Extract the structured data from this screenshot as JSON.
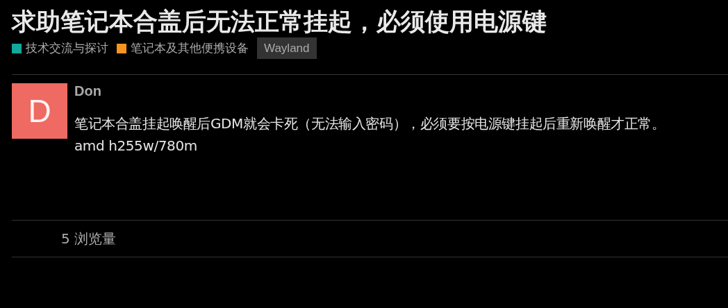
{
  "title": "求助笔记本合盖后无法正常挂起，必须使用电源键",
  "categories": [
    {
      "label": "技术交流与探讨",
      "color": "#12a89d"
    },
    {
      "label": "笔记本及其他便携设备",
      "color": "#f7941d"
    }
  ],
  "tags": [
    "Wayland"
  ],
  "post": {
    "avatar_letter": "D",
    "author": "Don",
    "body": [
      "笔记本合盖挂起唤醒后GDM就会卡死（无法输入密码），必须要按电源键挂起后重新唤醒才正常。",
      "amd h255w/780m"
    ]
  },
  "views": "5 浏览量"
}
